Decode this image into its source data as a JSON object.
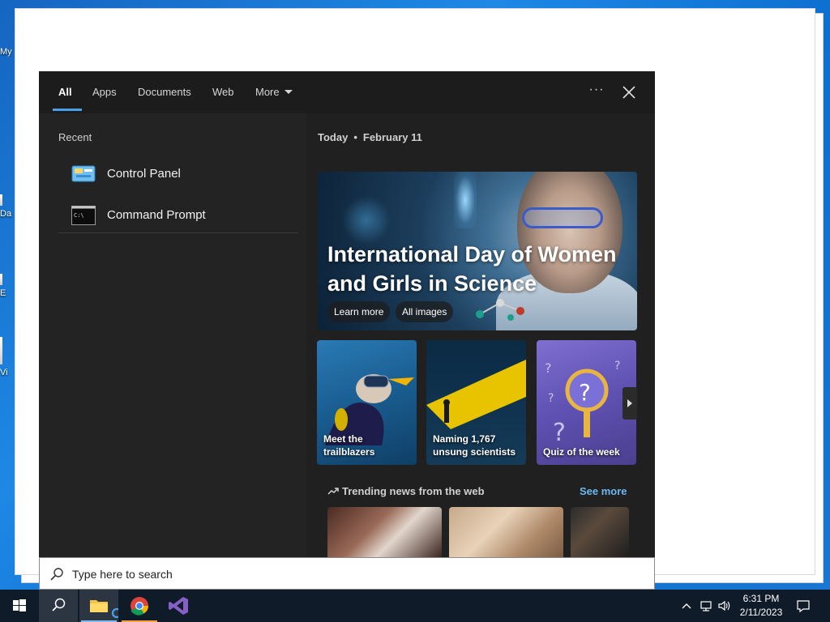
{
  "desktop": {
    "icons": [
      {
        "label": "My"
      },
      {
        "label": "Da"
      },
      {
        "label": "E"
      },
      {
        "label": "Vi"
      }
    ]
  },
  "search": {
    "tabs": [
      {
        "label": "All"
      },
      {
        "label": "Apps"
      },
      {
        "label": "Documents"
      },
      {
        "label": "Web"
      },
      {
        "label": "More"
      }
    ],
    "ellipsis": "···",
    "recent_title": "Recent",
    "recent_items": [
      {
        "label": "Control Panel",
        "icon": "control-panel-icon"
      },
      {
        "label": "Command Prompt",
        "icon": "command-prompt-icon"
      }
    ],
    "date_prefix": "Today",
    "date_separator": "•",
    "date": "February 11",
    "hero": {
      "title": "International Day of Women and Girls in Science",
      "buttons": [
        "Learn more",
        "All images"
      ]
    },
    "cards": [
      {
        "label": "Meet the trailblazers"
      },
      {
        "label": "Naming 1,767 unsung scientists"
      },
      {
        "label": "Quiz of the week"
      }
    ],
    "trending_title": "Trending news from the web",
    "see_more": "See more",
    "box_placeholder": "Type here to search"
  },
  "taskbar": {
    "apps": [
      "windows-start",
      "search",
      "file-explorer",
      "chrome",
      "visual-studio"
    ],
    "time": "6:31 PM",
    "date": "2/11/2023"
  },
  "colors": {
    "accent": "#4aa0e6",
    "see_more": "#6cb8f2",
    "flyout_bg": "#1f1f1f",
    "taskbar_bg": "#0f1b29"
  }
}
